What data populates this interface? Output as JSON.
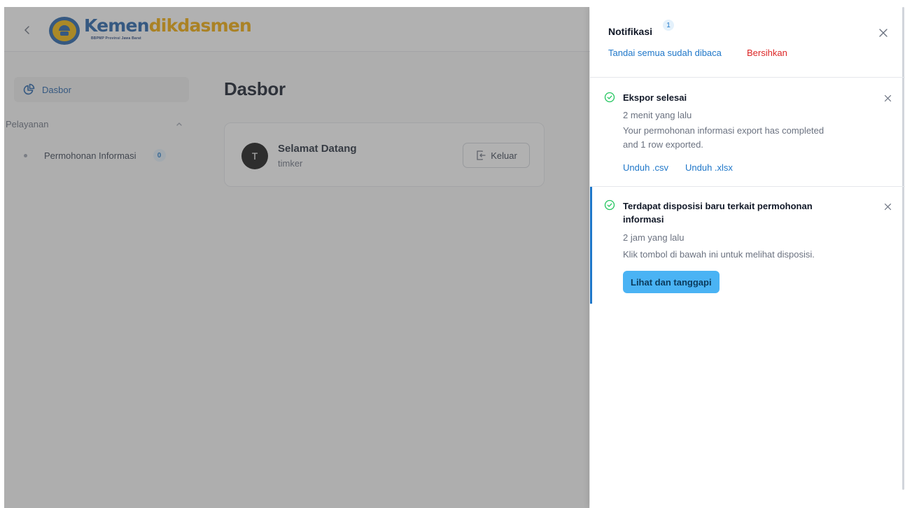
{
  "header": {
    "brand_part1": "Kemen",
    "brand_part2": "dikdasmen",
    "brand_subtitle": "BBPMP Provinsi Jawa Barat"
  },
  "sidebar": {
    "dasbor_label": "Dasbor",
    "section_label": "Pelayanan",
    "items": [
      {
        "label": "Permohonan Informasi",
        "count": "0"
      }
    ]
  },
  "main": {
    "title": "Dasbor",
    "welcome": {
      "avatar_initial": "T",
      "title": "Selamat Datang",
      "subtitle": "timker",
      "logout_label": "Keluar"
    }
  },
  "notifications": {
    "title": "Notifikasi",
    "count": "1",
    "mark_all_read": "Tandai semua sudah dibaca",
    "clear": "Bersihkan",
    "items": [
      {
        "title": "Ekspor selesai",
        "time": "2 menit yang lalu",
        "message_line1": "Your permohonan informasi export has completed",
        "message_line2": "and 1 row exported.",
        "link_csv": "Unduh .csv",
        "link_xlsx": "Unduh .xlsx"
      },
      {
        "title_line1": "Terdapat disposisi baru terkait permohonan",
        "title_line2": "informasi",
        "time": "2 jam yang lalu",
        "message": "Klik tombol di bawah ini untuk melihat disposisi.",
        "button_label": "Lihat dan tanggapi"
      }
    ]
  },
  "colors": {
    "accent": "#1f77c9",
    "brand_blue": "#1f5fa8",
    "brand_yellow": "#f2a900",
    "danger": "#dc2626",
    "success": "#22c55e",
    "button_bg": "#4ab3f4"
  },
  "icons": [
    "chevron-left-icon",
    "kemendikdasmen-logo",
    "chart-pie-icon",
    "chevron-up-icon",
    "logout-icon",
    "close-icon",
    "check-circle-icon"
  ]
}
